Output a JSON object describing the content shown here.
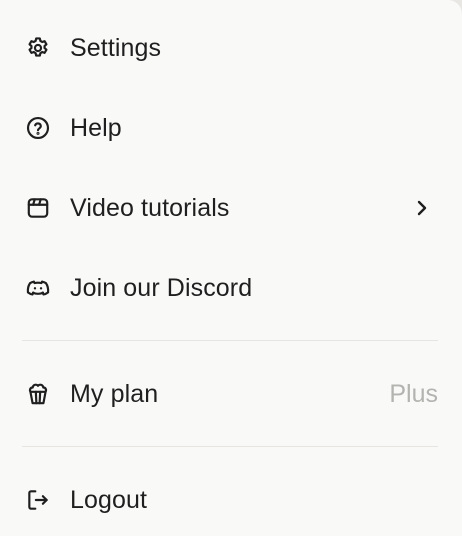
{
  "menu": {
    "items": [
      {
        "label": "Settings",
        "icon": "gear-icon"
      },
      {
        "label": "Help",
        "icon": "help-circle-icon"
      },
      {
        "label": "Video tutorials",
        "icon": "video-clapper-icon",
        "submenu_indicator": "chevron-right-icon"
      },
      {
        "label": "Join our Discord",
        "icon": "discord-icon"
      }
    ],
    "plan": {
      "label": "My plan",
      "icon": "popcorn-icon",
      "value": "Plus"
    },
    "logout": {
      "label": "Logout",
      "icon": "logout-icon"
    }
  },
  "colors": {
    "background": "#f9f9f8",
    "text": "#1f1f1f",
    "muted_text": "#b3b3b0",
    "divider": "#e6e5e2"
  }
}
